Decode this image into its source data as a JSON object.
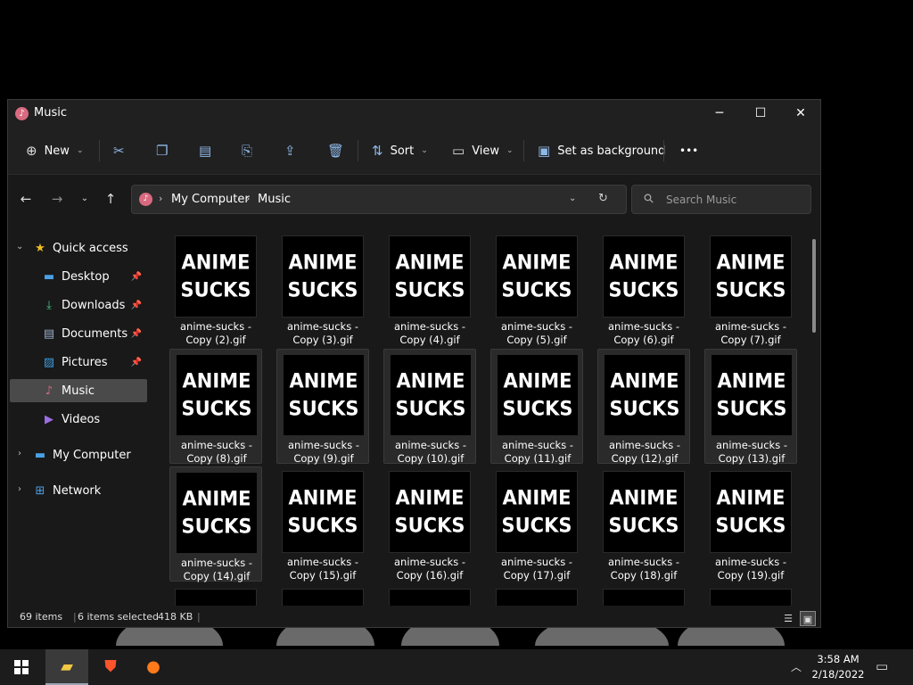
{
  "window": {
    "title": "Music",
    "icon": "music-note-icon",
    "controls": {
      "minimize": "─",
      "maximize": "☐",
      "close": "✕"
    }
  },
  "toolbar": {
    "new_label": "New",
    "sort_label": "Sort",
    "view_label": "View",
    "set_background_label": "Set as background",
    "more_label": "•••"
  },
  "address": {
    "crumbs": [
      "My Computer",
      "Music"
    ]
  },
  "search": {
    "placeholder": "Search Music"
  },
  "sidebar": {
    "quick_access": "Quick access",
    "items": [
      {
        "label": "Desktop",
        "icon": "desktop-icon",
        "pinned": true
      },
      {
        "label": "Downloads",
        "icon": "download-icon",
        "pinned": true
      },
      {
        "label": "Documents",
        "icon": "document-icon",
        "pinned": true
      },
      {
        "label": "Pictures",
        "icon": "picture-icon",
        "pinned": true
      },
      {
        "label": "Music",
        "icon": "music-note-icon",
        "pinned": false,
        "selected": true
      },
      {
        "label": "Videos",
        "icon": "video-icon",
        "pinned": false
      }
    ],
    "my_computer": "My Computer",
    "network": "Network"
  },
  "files": {
    "thumb_line1": "ANIME",
    "thumb_line2": "SUCKS",
    "items": [
      {
        "line1": "anime-sucks -",
        "line2": "Copy (2).gif",
        "selected": false
      },
      {
        "line1": "anime-sucks -",
        "line2": "Copy (3).gif",
        "selected": false
      },
      {
        "line1": "anime-sucks -",
        "line2": "Copy (4).gif",
        "selected": false
      },
      {
        "line1": "anime-sucks -",
        "line2": "Copy (5).gif",
        "selected": false
      },
      {
        "line1": "anime-sucks -",
        "line2": "Copy (6).gif",
        "selected": false
      },
      {
        "line1": "anime-sucks -",
        "line2": "Copy (7).gif",
        "selected": false
      },
      {
        "line1": "anime-sucks -",
        "line2": "Copy (8).gif",
        "selected": true
      },
      {
        "line1": "anime-sucks -",
        "line2": "Copy (9).gif",
        "selected": true
      },
      {
        "line1": "anime-sucks -",
        "line2": "Copy (10).gif",
        "selected": true
      },
      {
        "line1": "anime-sucks -",
        "line2": "Copy (11).gif",
        "selected": true
      },
      {
        "line1": "anime-sucks -",
        "line2": "Copy (12).gif",
        "selected": true
      },
      {
        "line1": "anime-sucks -",
        "line2": "Copy (13).gif",
        "selected": true
      },
      {
        "line1": "anime-sucks -",
        "line2": "Copy (14).gif",
        "selected": true
      },
      {
        "line1": "anime-sucks -",
        "line2": "Copy (15).gif",
        "selected": false
      },
      {
        "line1": "anime-sucks -",
        "line2": "Copy (16).gif",
        "selected": false
      },
      {
        "line1": "anime-sucks -",
        "line2": "Copy (17).gif",
        "selected": false
      },
      {
        "line1": "anime-sucks -",
        "line2": "Copy (18).gif",
        "selected": false
      },
      {
        "line1": "anime-sucks -",
        "line2": "Copy (19).gif",
        "selected": false
      },
      {
        "line1": "",
        "line2": "",
        "selected": false
      },
      {
        "line1": "",
        "line2": "",
        "selected": false
      },
      {
        "line1": "",
        "line2": "",
        "selected": false
      },
      {
        "line1": "",
        "line2": "",
        "selected": false
      },
      {
        "line1": "",
        "line2": "",
        "selected": false
      },
      {
        "line1": "",
        "line2": "",
        "selected": false
      }
    ]
  },
  "status": {
    "count": "69 items",
    "selected": "6 items selected",
    "size": "418 KB",
    "sep": "|"
  },
  "taskbar": {
    "apps": [
      {
        "name": "file-explorer",
        "icon": "folder-icon",
        "active": true
      },
      {
        "name": "brave",
        "icon": "brave-lion-icon",
        "active": false
      },
      {
        "name": "firefox",
        "icon": "firefox-icon",
        "active": false
      }
    ],
    "time": "3:58 AM",
    "date": "2/18/2022"
  },
  "colors": {
    "accent": "#8fb8e8",
    "music_icon": "#d86a80",
    "selection": "#4a4a4a"
  }
}
